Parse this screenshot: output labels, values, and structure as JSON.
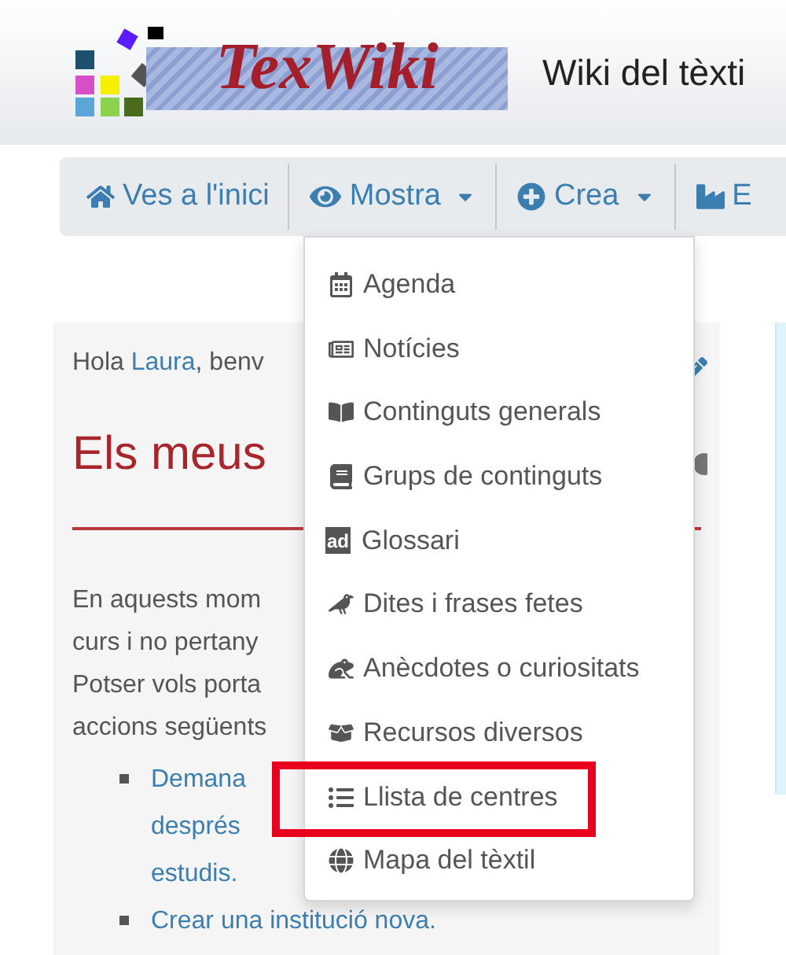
{
  "header": {
    "logo_text": "TexWiki",
    "site_title": "Wiki del tèxti"
  },
  "nav": [
    {
      "label": "Ves a l'inici",
      "kind": "home",
      "caret": false
    },
    {
      "label": "Mostra",
      "kind": "eye",
      "caret": true
    },
    {
      "label": "Crea",
      "kind": "plus",
      "caret": true
    },
    {
      "label": "E",
      "kind": "factory",
      "caret": false
    }
  ],
  "greeting": {
    "text": "Hola ",
    "user": "Laura",
    "rest": ", benv"
  },
  "heading": "Els meus",
  "paragraph_lines": [
    "En aquests mom",
    "curs i no pertany",
    "Potser vols porta",
    "accions següents"
  ],
  "actions": [
    {
      "lines": [
        "Demana",
        "després",
        "estudis."
      ]
    },
    {
      "lines": [
        "Crear una institució nova."
      ]
    }
  ],
  "menu": [
    {
      "label": "Agenda",
      "kind": "calendar",
      "highlighted": false
    },
    {
      "label": "Notícies",
      "kind": "news",
      "highlighted": false
    },
    {
      "label": "Continguts generals",
      "kind": "book-open",
      "highlighted": false
    },
    {
      "label": "Grups de continguts",
      "kind": "book",
      "highlighted": false
    },
    {
      "label": "Glossari",
      "kind": "glossary",
      "icon_text": "ad",
      "highlighted": false
    },
    {
      "label": "Dites i frases fetes",
      "kind": "crow",
      "highlighted": false
    },
    {
      "label": "Anècdotes o curiositats",
      "kind": "frog",
      "highlighted": false
    },
    {
      "label": "Recursos diversos",
      "kind": "box",
      "highlighted": false
    },
    {
      "label": "Llista de centres",
      "kind": "list",
      "highlighted": true
    },
    {
      "label": "Mapa del tèxtil",
      "kind": "globe",
      "highlighted": false
    }
  ]
}
